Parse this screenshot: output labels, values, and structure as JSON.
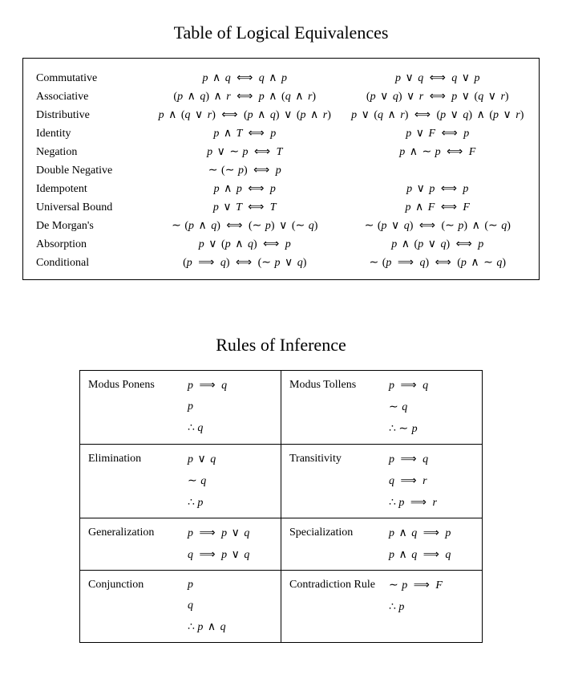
{
  "titles": {
    "equiv": "Table of Logical Equivalences",
    "inference": "Rules of Inference"
  },
  "equiv": [
    {
      "name": "Commutative",
      "c1": "p ∧ q  ⟺  q ∧ p",
      "c2": "p ∨ q  ⟺  q ∨ p"
    },
    {
      "name": "Associative",
      "c1": "(p ∧ q) ∧ r  ⟺  p ∧ (q ∧ r)",
      "c2": "(p ∨ q) ∨ r  ⟺  p ∨ (q ∨ r)"
    },
    {
      "name": "Distributive",
      "c1": "p ∧ (q ∨ r)  ⟺  (p ∧ q) ∨ (p ∧ r)",
      "c2": "p ∨ (q ∧ r)  ⟺  (p ∨ q) ∧ (p ∨ r)"
    },
    {
      "name": "Identity",
      "c1": "p ∧ T  ⟺  p",
      "c2": "p ∨ F  ⟺  p"
    },
    {
      "name": "Negation",
      "c1": "p ∨ ∼ p  ⟺  T",
      "c2": "p ∧ ∼ p  ⟺  F"
    },
    {
      "name": "Double Negative",
      "c1": "∼ (∼ p)  ⟺  p",
      "c2": ""
    },
    {
      "name": "Idempotent",
      "c1": "p ∧ p  ⟺  p",
      "c2": "p ∨ p  ⟺  p"
    },
    {
      "name": "Universal Bound",
      "c1": "p ∨ T  ⟺  T",
      "c2": "p ∧ F  ⟺  F"
    },
    {
      "name": "De Morgan's",
      "c1": "∼ (p ∧ q)  ⟺  (∼ p) ∨ (∼ q)",
      "c2": "∼ (p ∨ q)  ⟺  (∼ p) ∧ (∼ q)"
    },
    {
      "name": "Absorption",
      "c1": "p ∨ (p ∧ q)  ⟺  p",
      "c2": "p ∧ (p ∨ q)  ⟺  p"
    },
    {
      "name": "Conditional",
      "c1": "(p ⟹ q)  ⟺  (∼ p ∨ q)",
      "c2": "∼ (p ⟹ q)  ⟺  (p ∧ ∼ q)"
    }
  ],
  "inference": [
    [
      {
        "name": "Modus Ponens",
        "lines": [
          "p ⟹ q",
          "p",
          "∴ q"
        ]
      },
      {
        "name": "Modus Tollens",
        "lines": [
          "p ⟹ q",
          "∼ q",
          "∴ ∼ p"
        ]
      }
    ],
    [
      {
        "name": "Elimination",
        "lines": [
          "p ∨ q",
          "∼ q",
          "∴ p"
        ]
      },
      {
        "name": "Transitivity",
        "lines": [
          "p ⟹ q",
          "q ⟹ r",
          "∴ p ⟹ r"
        ]
      }
    ],
    [
      {
        "name": "Generalization",
        "lines": [
          "p ⟹ p ∨ q",
          "q ⟹ p ∨ q"
        ]
      },
      {
        "name": "Specialization",
        "lines": [
          "p ∧ q ⟹ p",
          "p ∧ q ⟹ q"
        ]
      }
    ],
    [
      {
        "name": "Conjunction",
        "lines": [
          "p",
          "q",
          "∴ p ∧ q"
        ]
      },
      {
        "name": "Contradiction Rule",
        "lines": [
          "∼ p ⟹ F",
          "∴ p"
        ]
      }
    ]
  ]
}
